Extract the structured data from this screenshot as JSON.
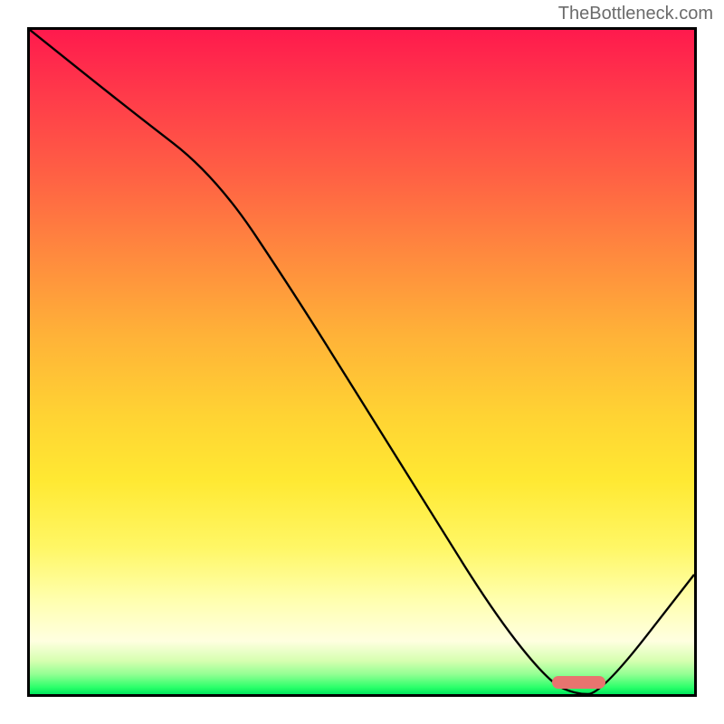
{
  "watermark": "TheBottleneck.com",
  "chart_data": {
    "type": "line",
    "title": "",
    "xlabel": "",
    "ylabel": "",
    "x": [
      0,
      15,
      28,
      40,
      50,
      60,
      70,
      78,
      82,
      86,
      100
    ],
    "values": [
      100,
      88,
      78,
      60,
      44,
      28,
      12,
      2,
      0,
      0,
      18
    ],
    "xlim": [
      0,
      100
    ],
    "ylim": [
      0,
      100
    ],
    "optimal_range": {
      "start": 78,
      "end": 86
    },
    "gradient_stops": [
      {
        "pct": 0,
        "color": "#ff1a4d"
      },
      {
        "pct": 50,
        "color": "#ffc933"
      },
      {
        "pct": 88,
        "color": "#ffffcc"
      },
      {
        "pct": 100,
        "color": "#00e65c"
      }
    ]
  }
}
